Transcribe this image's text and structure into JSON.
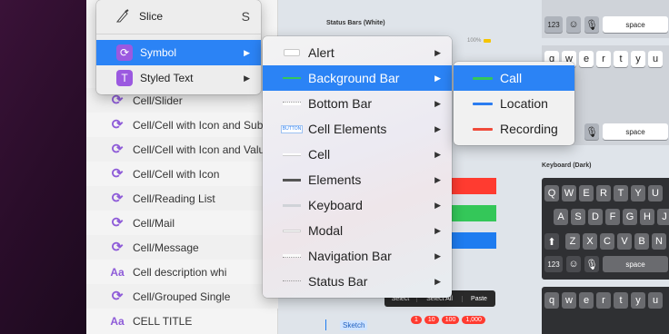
{
  "menu_main": {
    "slice": {
      "label": "Slice",
      "shortcut": "S"
    },
    "symbol": {
      "label": "Symbol"
    },
    "styled_text": {
      "label": "Styled Text"
    }
  },
  "symbol_submenu": [
    {
      "label": "Alert",
      "thumb": "alert"
    },
    {
      "label": "Background Bar",
      "thumb": "bgbar",
      "selected": true
    },
    {
      "label": "Bottom Bar",
      "thumb": "bottombar"
    },
    {
      "label": "Cell Elements",
      "thumb": "button",
      "thumb_text": "BUTTON"
    },
    {
      "label": "Cell",
      "thumb": "cell"
    },
    {
      "label": "Elements",
      "thumb": "elements"
    },
    {
      "label": "Keyboard",
      "thumb": "keyboard"
    },
    {
      "label": "Modal",
      "thumb": "modal"
    },
    {
      "label": "Navigation Bar",
      "thumb": "navbar"
    },
    {
      "label": "Status Bar",
      "thumb": "statusbar"
    }
  ],
  "background_bar_submenu": [
    {
      "label": "Call",
      "color": "#34c759",
      "selected": true
    },
    {
      "label": "Location",
      "color": "#2b7cf0"
    },
    {
      "label": "Recording",
      "color": "#f04a3a"
    }
  ],
  "layers": [
    {
      "label": "Cell/Slider",
      "icon": "symbol-icon"
    },
    {
      "label": "Cell/Cell with Icon and Sub",
      "icon": "symbol-icon"
    },
    {
      "label": "Cell/Cell with Icon and Valu",
      "icon": "symbol-icon"
    },
    {
      "label": "Cell/Cell with Icon",
      "icon": "symbol-icon"
    },
    {
      "label": "Cell/Reading List",
      "icon": "symbol-icon"
    },
    {
      "label": "Cell/Mail",
      "icon": "symbol-icon"
    },
    {
      "label": "Cell/Message",
      "icon": "symbol-icon"
    },
    {
      "label": "Cell description whi",
      "icon": "text-icon"
    },
    {
      "label": "Cell/Grouped Single",
      "icon": "symbol-icon"
    },
    {
      "label": "CELL TITLE",
      "icon": "text-icon"
    }
  ],
  "canvas": {
    "status_bars_title": "Status Bars (White)",
    "battery_text": "100%",
    "keyboard_dark_title": "Keyboard (Dark)",
    "space_label": "space",
    "num_label": "123",
    "edit_menu": [
      "Select",
      "Select All",
      "Paste"
    ],
    "sketch_label": "Sketch",
    "badges": [
      "1",
      "10",
      "100",
      "1,000"
    ],
    "keyboard_row1": [
      "q",
      "w",
      "e",
      "r",
      "t",
      "y",
      "u"
    ],
    "keyboard_dark_row1": [
      "Q",
      "W",
      "E",
      "R",
      "T",
      "Y",
      "U"
    ],
    "keyboard_dark_row2": [
      "A",
      "S",
      "D",
      "F",
      "G",
      "H",
      "J"
    ],
    "keyboard_dark_row3": [
      "Z",
      "X",
      "C",
      "V",
      "B",
      "N"
    ]
  }
}
